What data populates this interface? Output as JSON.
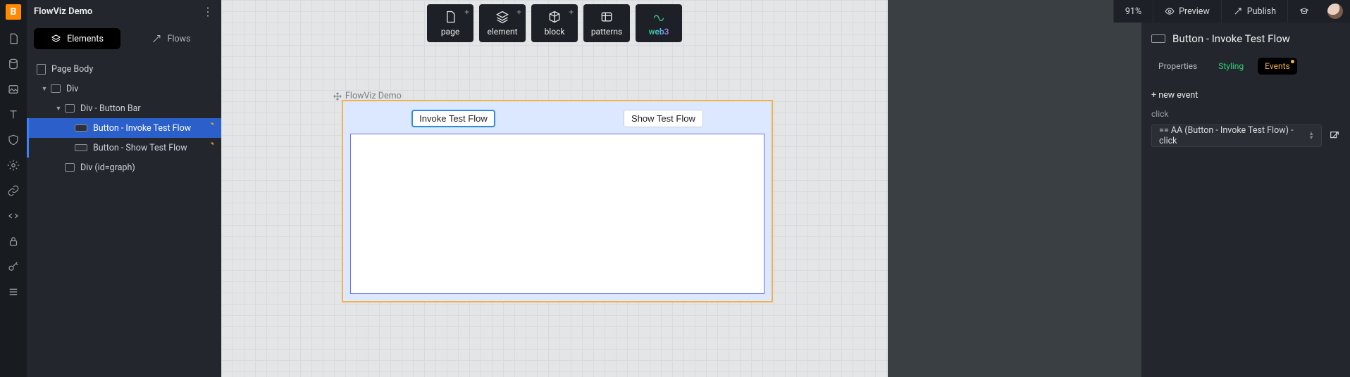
{
  "project": {
    "title": "FlowViz Demo"
  },
  "leftTabs": {
    "elements": "Elements",
    "flows": "Flows"
  },
  "tree": {
    "pageBody": "Page Body",
    "div": "Div",
    "buttonBar": "Div - Button Bar",
    "btnInvoke": "Button - Invoke Test Flow",
    "btnShow": "Button - Show Test Flow",
    "divGraph": "Div (id=graph)"
  },
  "toolbar": {
    "page": "page",
    "element": "element",
    "block": "block",
    "patterns": "patterns",
    "web3": "web3"
  },
  "artboard": {
    "label": "FlowViz Demo",
    "invokeBtn": "Invoke Test Flow",
    "showBtn": "Show Test Flow"
  },
  "topRight": {
    "zoom": "91%",
    "preview": "Preview",
    "publish": "Publish"
  },
  "rightPanel": {
    "title": "Button - Invoke Test Flow",
    "tabs": {
      "properties": "Properties",
      "styling": "Styling",
      "events": "Events"
    },
    "addEvent": "+ new event",
    "eventKind": "click",
    "eventRow": "== AA (Button - Invoke Test Flow) - click"
  }
}
